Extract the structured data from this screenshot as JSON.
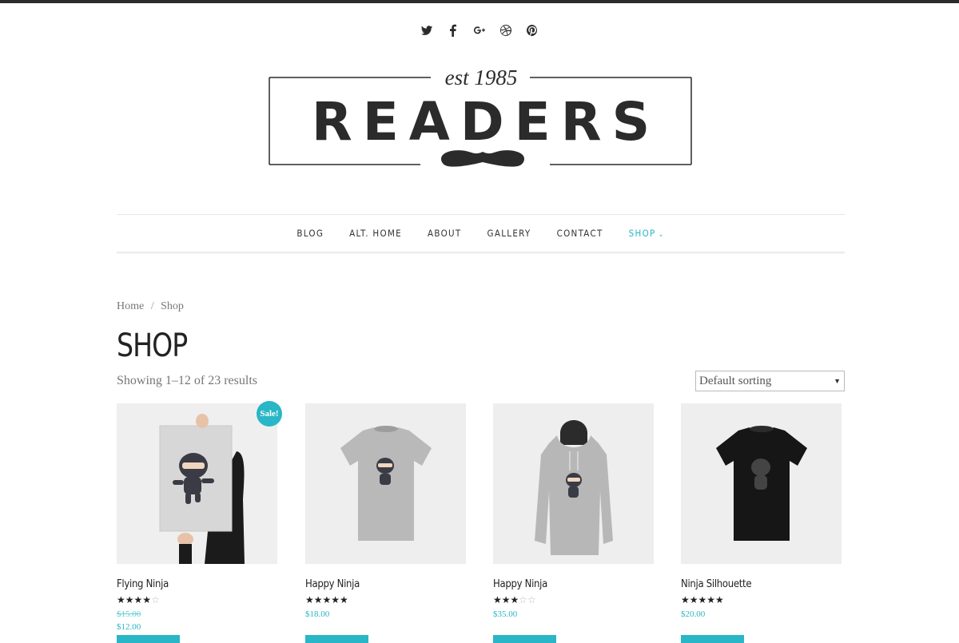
{
  "social": {
    "icons": [
      "twitter-icon",
      "facebook-icon",
      "google-plus-icon",
      "dribbble-icon",
      "pinterest-icon"
    ]
  },
  "logo": {
    "tagline": "est 1985",
    "brand": "READERS"
  },
  "nav": {
    "items": [
      "BLOG",
      "ALT. HOME",
      "ABOUT",
      "GALLERY",
      "CONTACT",
      "SHOP"
    ],
    "active_item": "SHOP",
    "accent_color": "#29b6c6"
  },
  "breadcrumb": {
    "home": "Home",
    "separator": "/",
    "current": "Shop"
  },
  "page": {
    "title": "SHOP",
    "result_count": "Showing 1–12 of 23 results",
    "sort_selected": "Default sorting"
  },
  "products": [
    {
      "name": "Flying Ninja",
      "rating": 4,
      "old_price": "$15.00",
      "price": "$12.00",
      "sale_badge": "Sale!"
    },
    {
      "name": "Happy Ninja",
      "rating": 5,
      "price": "$18.00"
    },
    {
      "name": "Happy Ninja",
      "rating": 3,
      "price": "$35.00"
    },
    {
      "name": "Ninja Silhouette",
      "rating": 5,
      "price": "$20.00"
    }
  ]
}
